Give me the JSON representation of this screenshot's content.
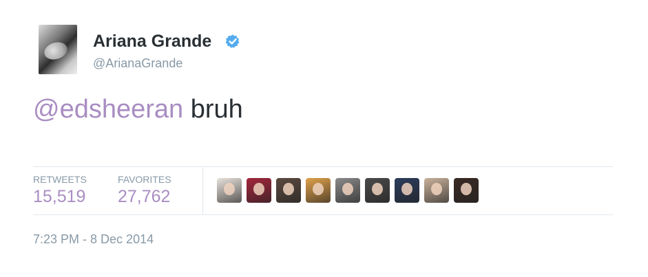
{
  "user": {
    "display_name": "Ariana Grande",
    "handle": "@ArianaGrande",
    "verified": true,
    "avatar_icon": "profile-photo"
  },
  "tweet": {
    "mention": "@edsheeran",
    "text_after_mention": " bruh"
  },
  "stats": {
    "retweets_label": "RETWEETS",
    "retweets_value": "15,519",
    "favorites_label": "FAVORITES",
    "favorites_value": "27,762"
  },
  "favoriters": {
    "avatars": [
      {
        "icon": "user-avatar",
        "color": "#e8e2dc"
      },
      {
        "icon": "user-avatar",
        "color": "#a3263c"
      },
      {
        "icon": "user-avatar",
        "color": "#5b4a40"
      },
      {
        "icon": "user-avatar",
        "color": "#e0a14a"
      },
      {
        "icon": "user-avatar",
        "color": "#8a8a8a"
      },
      {
        "icon": "user-avatar",
        "color": "#4a4a4a"
      },
      {
        "icon": "user-avatar",
        "color": "#2c3d5c"
      },
      {
        "icon": "user-avatar",
        "color": "#c9b19a"
      },
      {
        "icon": "user-avatar",
        "color": "#3a2a24"
      }
    ]
  },
  "timestamp": "7:23 PM - 8 Dec 2014",
  "colors": {
    "link": "#a98dc2",
    "muted": "#8899a6",
    "text": "#292f33",
    "verified": "#55acee",
    "divider": "#e1e8ed"
  }
}
